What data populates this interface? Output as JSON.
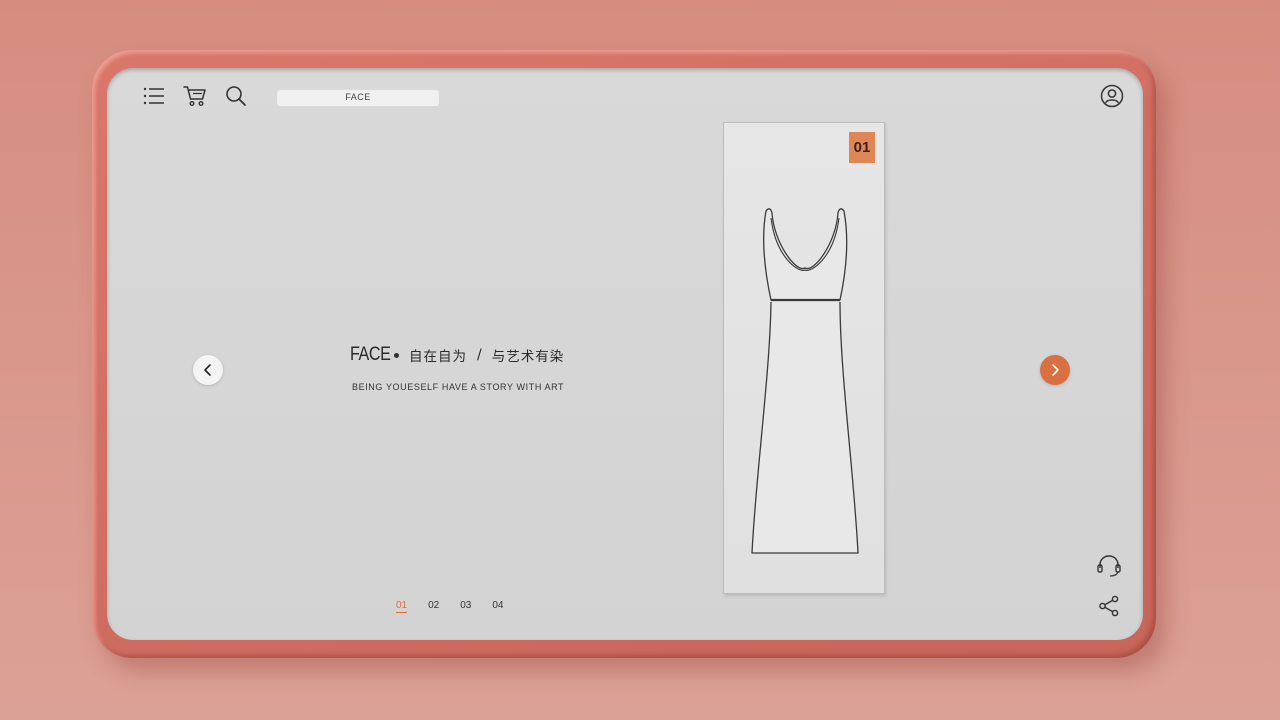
{
  "toolbar": {
    "search_value": "FACE"
  },
  "headline": {
    "brand": "FACE",
    "part1": "自在自为",
    "separator": "/",
    "part2": "与艺术有染"
  },
  "subtitle": "BEING YOUESELF HAVE A STORY WITH ART",
  "pager": {
    "pages": [
      "01",
      "02",
      "03",
      "04"
    ],
    "active_index": 0
  },
  "card": {
    "badge": "01"
  },
  "colors": {
    "accent": "#d87041",
    "badge": "#df8656",
    "frame": "#cf6e62",
    "screen": "#d6d6d6"
  },
  "icons": {
    "menu": "menu-icon",
    "cart": "cart-icon",
    "search": "search-icon",
    "user": "user-icon",
    "prev": "chevron-left-icon",
    "next": "chevron-right-icon",
    "support": "headset-icon",
    "share": "share-icon"
  }
}
